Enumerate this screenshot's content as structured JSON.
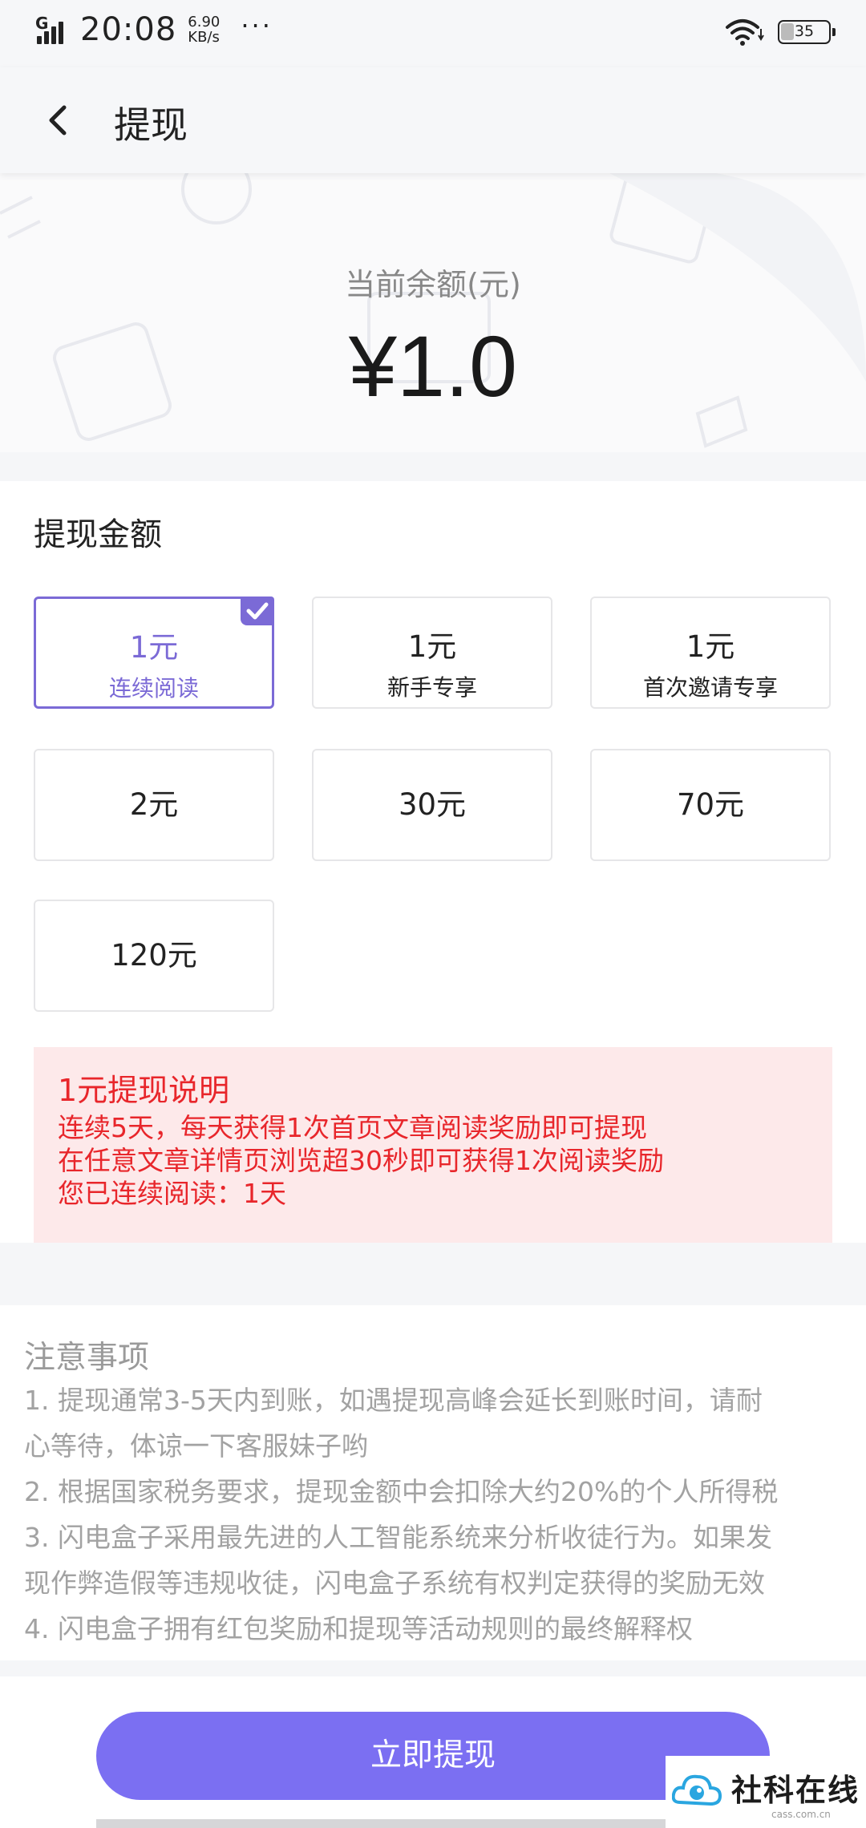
{
  "status_bar": {
    "network": "G",
    "time": "20:08",
    "speed_value": "6.90",
    "speed_unit": "KB/s",
    "more": "···",
    "battery": "35"
  },
  "header": {
    "title": "提现"
  },
  "balance": {
    "label": "当前余额(元)",
    "value": "¥1.0"
  },
  "amount": {
    "title": "提现金额",
    "options": [
      {
        "amount": "1元",
        "desc": "连续阅读",
        "selected": true
      },
      {
        "amount": "1元",
        "desc": "新手专享"
      },
      {
        "amount": "1元",
        "desc": "首次邀请专享"
      },
      {
        "amount": "2元"
      },
      {
        "amount": "30元"
      },
      {
        "amount": "70元"
      },
      {
        "amount": "120元"
      }
    ]
  },
  "notice": {
    "title": "1元提现说明",
    "lines": [
      "连续5天，每天获得1次首页文章阅读奖励即可提现",
      "在任意文章详情页浏览超30秒即可获得1次阅读奖励",
      "您已连续阅读：1天"
    ]
  },
  "notes": {
    "title": "注意事项",
    "items": [
      "1. 提现通常3-5天内到账，如遇提现高峰会延长到账时间，请耐",
      "心等待，体谅一下客服妹子哟",
      "2. 根据国家税务要求，提现金额中会扣除大约20%的个人所得税",
      "3. 闪电盒子采用最先进的人工智能系统来分析收徒行为。如果发",
      "现作弊造假等违规收徒，闪电盒子系统有权判定获得的奖励无效",
      "4. 闪电盒子拥有红包奖励和提现等活动规则的最终解释权"
    ]
  },
  "action": {
    "submit": "立即提现"
  },
  "watermark": {
    "text": "社科在线",
    "sub": "cass.com.cn"
  },
  "colors": {
    "accent": "#7b6ff2",
    "selected": "#7b6ad6",
    "notice_text": "#e8262b",
    "notice_bg": "#fde9ea"
  }
}
